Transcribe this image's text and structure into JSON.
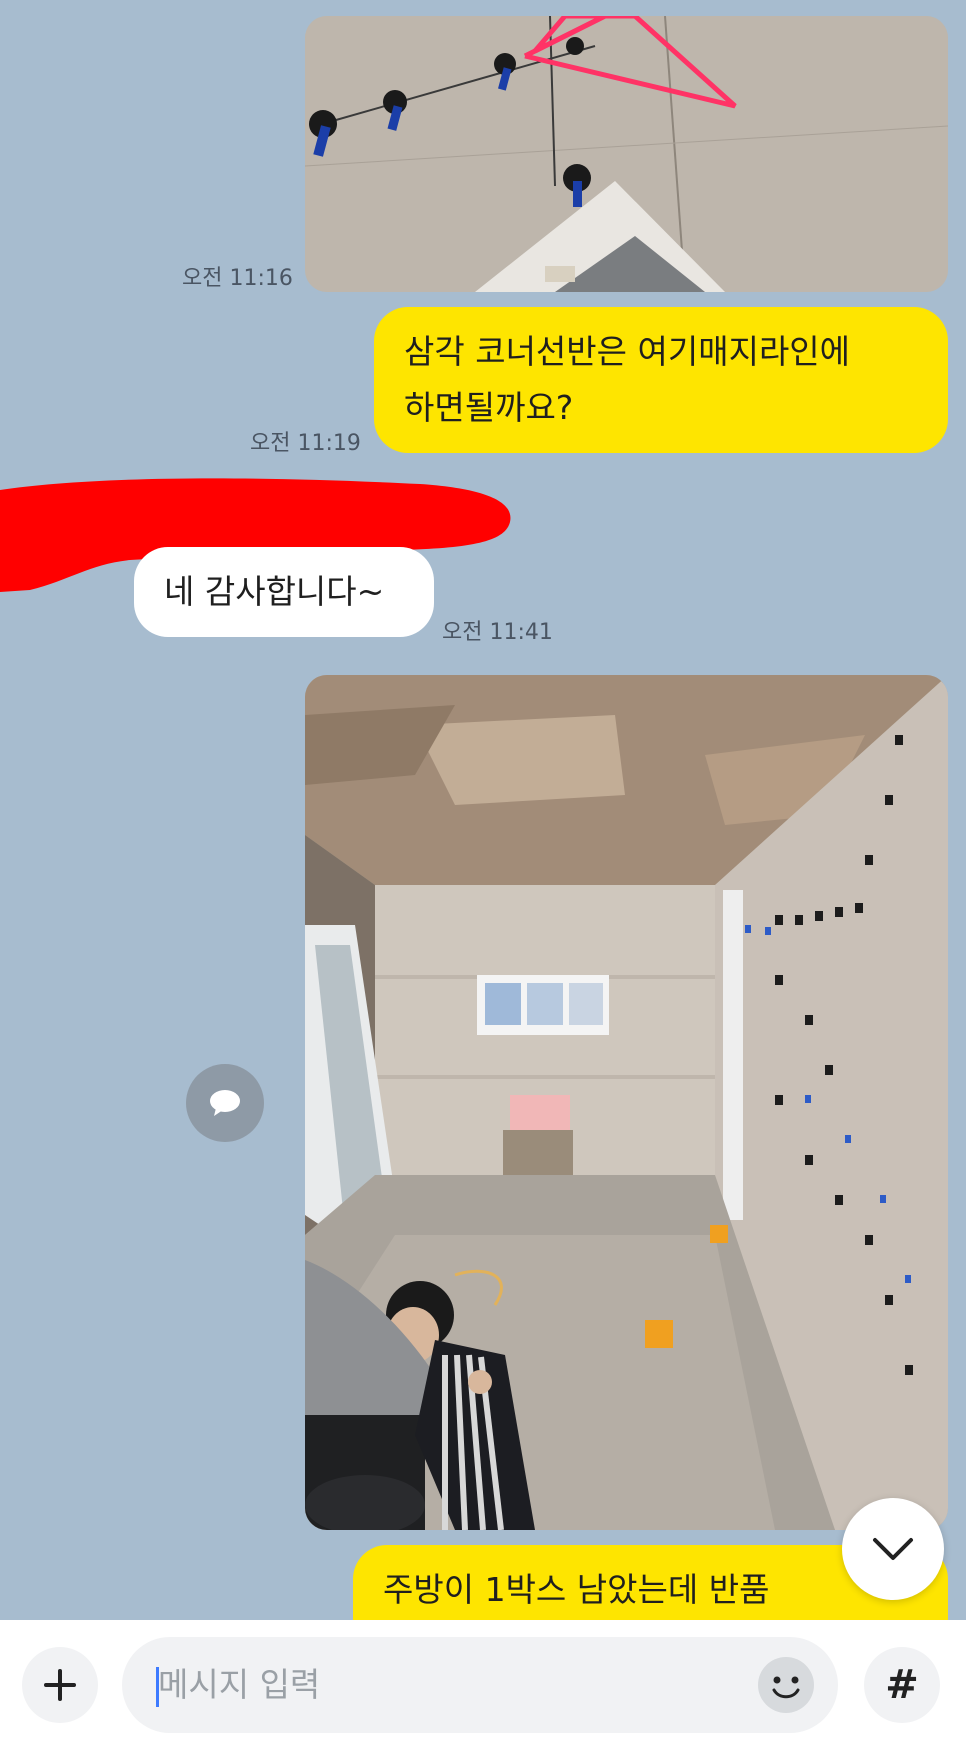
{
  "chat": {
    "messages": [
      {
        "type": "image",
        "sender": "me",
        "time": "오전 11:16",
        "image_name": "tile-leveling-clips-photo"
      },
      {
        "type": "text",
        "sender": "me",
        "time": "오전 11:19",
        "lines": [
          "삼각 코너선반은 여기매지라인에",
          "하면될까요?"
        ]
      },
      {
        "type": "text",
        "sender": "other",
        "time": "오전 11:41",
        "text": "네 감사합니다~"
      },
      {
        "type": "image",
        "sender": "me",
        "image_name": "bathroom-renovation-photo"
      },
      {
        "type": "text",
        "sender": "me",
        "text": "주방이 1박스 남았는데 반품"
      }
    ]
  },
  "composer": {
    "placeholder": "메시지 입력",
    "hash_label": "#"
  },
  "colors": {
    "background": "#a7bccf",
    "my_bubble": "#fee500",
    "their_bubble": "#ffffff",
    "redaction": "#ff0000",
    "annotation": "#ff3366"
  },
  "icons": {
    "attach": "plus-icon",
    "emoji": "emoji-icon",
    "share": "share-chat-icon",
    "scroll": "chevron-down-icon"
  }
}
